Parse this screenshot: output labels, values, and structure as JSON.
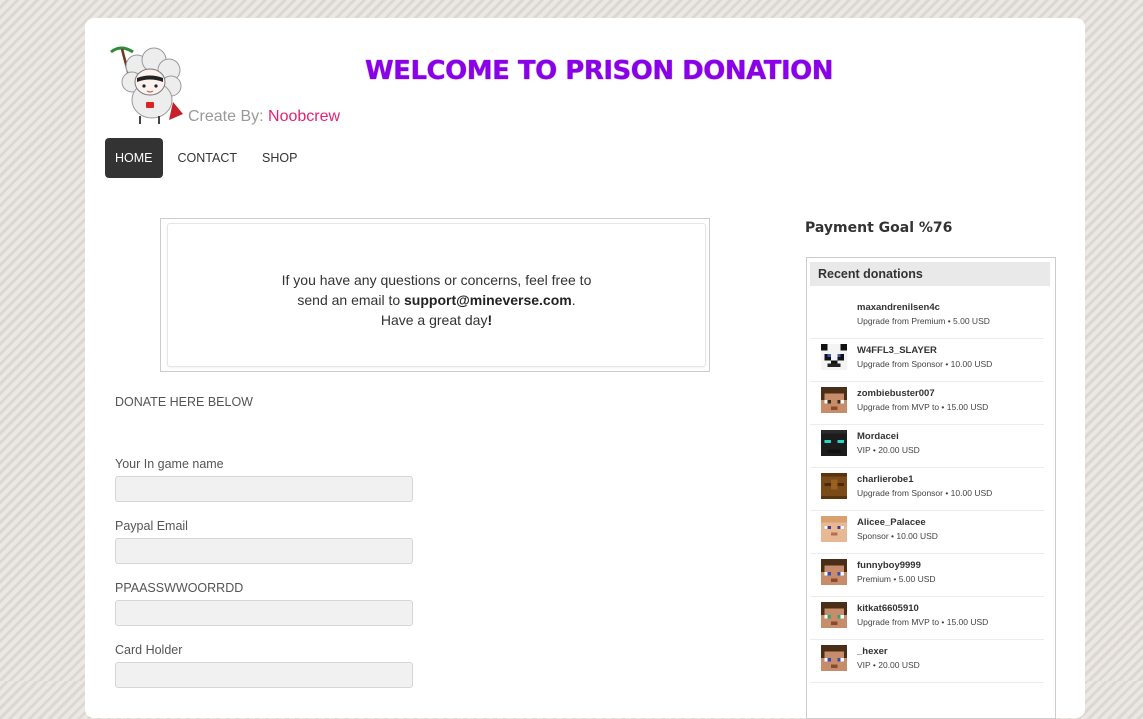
{
  "header": {
    "title": "WELCOME TO PRISON DONATION",
    "byline_prefix": "Create By:",
    "author": "Noobcrew"
  },
  "nav": {
    "items": [
      {
        "label": "HOME",
        "active": true
      },
      {
        "label": "CONTACT",
        "active": false
      },
      {
        "label": "SHOP",
        "active": false
      }
    ]
  },
  "notice": {
    "line1": "If you have any questions or concerns, feel free to",
    "line2_prefix": "send an email to",
    "email": "support@mineverse.com",
    "line2_suffix": ".",
    "line3_prefix": "Have a great day",
    "line3_suffix": "!"
  },
  "form": {
    "heading": "DONATE HERE BELOW",
    "fields": [
      {
        "label": "Your In game name",
        "value": ""
      },
      {
        "label": "Paypal Email",
        "value": ""
      },
      {
        "label": "PPAASSWWOORRDD",
        "value": ""
      },
      {
        "label": "Card Holder",
        "value": ""
      }
    ]
  },
  "sidebar": {
    "goal_title": "Payment Goal %76",
    "donations_title": "Recent donations",
    "donations": [
      {
        "name": "maxandrenilsen4c",
        "detail": "Upgrade from Premium • 5.00 USD",
        "skin": "blank"
      },
      {
        "name": "W4FFL3_SLAYER",
        "detail": "Upgrade from Sponsor • 10.00 USD",
        "skin": "panda"
      },
      {
        "name": "zombiebuster007",
        "detail": "Upgrade from MVP to • 15.00 USD",
        "skin": "brown-hair"
      },
      {
        "name": "Mordacei",
        "detail": "VIP • 20.00 USD",
        "skin": "dark-cyan-eyes"
      },
      {
        "name": "charlierobe1",
        "detail": "Upgrade from Sponsor • 10.00 USD",
        "skin": "wood"
      },
      {
        "name": "Alicee_Palacee",
        "detail": "Sponsor • 10.00 USD",
        "skin": "pale"
      },
      {
        "name": "funnyboy9999",
        "detail": "Premium • 5.00 USD",
        "skin": "brown-hair-blue"
      },
      {
        "name": "kitkat6605910",
        "detail": "Upgrade from MVP to • 15.00 USD",
        "skin": "brown-hair-green"
      },
      {
        "name": "_hexer",
        "detail": "VIP • 20.00 USD",
        "skin": "brown-hair-blue"
      }
    ]
  },
  "colors": {
    "title": "#8a00e8",
    "author": "#e8206f",
    "nav_active_bg": "#333333"
  }
}
